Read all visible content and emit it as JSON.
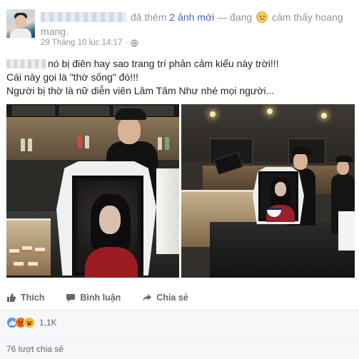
{
  "post": {
    "header": {
      "action_text": "đã thêm",
      "photos_link": "2 ảnh mới",
      "separator": "— đang",
      "feeling": "cảm thấy",
      "feeling_value": "hoang mang."
    },
    "timestamp": "29 Tháng 10 lúc 14:17",
    "text_lines": [
      "nó bị điên hay sao trang trí phản cảm kiểu này trời!!!",
      "Cái này gọi là \"thờ sống\" đó!!!",
      "Người bị thờ là nữ diễn viên Lâm Tâm Như nhé mọi người..."
    ]
  },
  "actions": {
    "like_label": "Thích",
    "comment_label": "Bình luận",
    "share_label": "Chia sẻ"
  },
  "reactions": {
    "types": [
      "like",
      "angry",
      "haha"
    ],
    "count": "1,1K"
  },
  "shares": {
    "text": "76 lượt chia sẻ"
  },
  "icons": {
    "globe": "globe-icon",
    "like": "thumbs-up-icon",
    "comment": "comment-bubble-icon",
    "share": "share-arrow-icon"
  },
  "colors": {
    "link_blue": "#4267b2",
    "meta_gray": "#90949c",
    "action_gray": "#616770",
    "like_blue": "#5890ff",
    "angry_orange": "#e9710f",
    "haha_yellow": "#f7b125"
  }
}
